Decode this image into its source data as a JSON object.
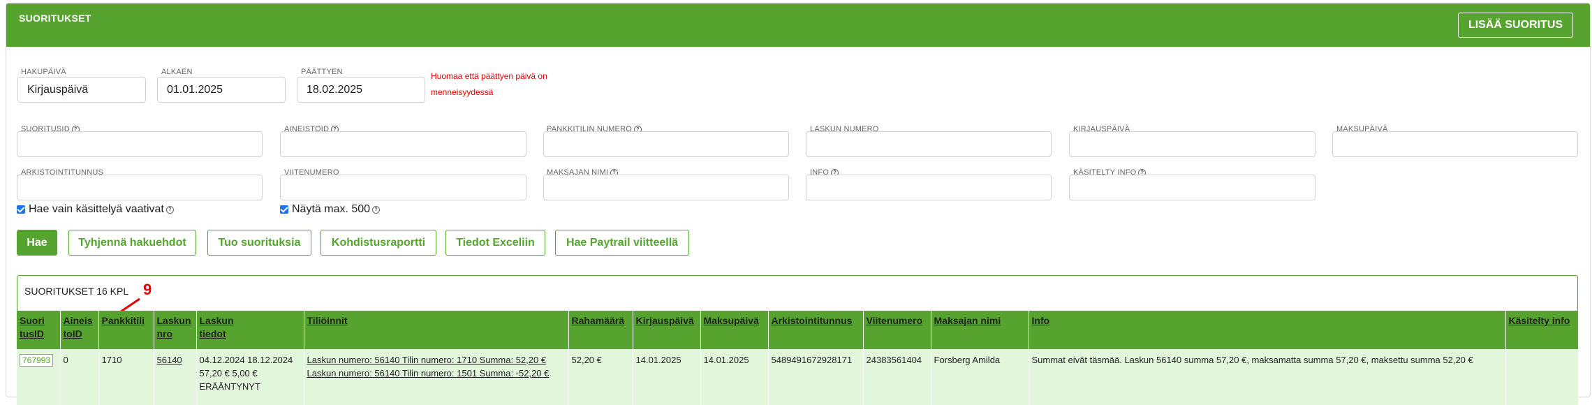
{
  "header": {
    "title": "SUORITUKSET",
    "add_button": "LISÄÄ SUORITUS"
  },
  "filters": {
    "hakupaiva": {
      "label": "HAKUPÄIVÄ",
      "value": "Kirjauspäivä"
    },
    "alkaen": {
      "label": "ALKAEN",
      "value": "01.01.2025"
    },
    "paattyen": {
      "label": "PÄÄTTYEN",
      "value": "18.02.2025"
    },
    "warning_line1": "Huomaa että päättyen päivä on",
    "warning_line2": "menneisyydessä",
    "suoritusid": {
      "label": "SUORITUSID",
      "value": ""
    },
    "aineistoid": {
      "label": "AINEISTOID",
      "value": ""
    },
    "pankkitilin_numero": {
      "label": "PANKKITILIN NUMERO",
      "value": ""
    },
    "laskun_numero": {
      "label": "LASKUN NUMERO",
      "value": ""
    },
    "kirjauspaiva": {
      "label": "KIRJAUSPÄIVÄ",
      "value": ""
    },
    "maksupaiva": {
      "label": "MAKSUPÄIVÄ",
      "value": ""
    },
    "arkistointitunnus": {
      "label": "ARKISTOINTITUNNUS",
      "value": ""
    },
    "viitenumero": {
      "label": "VIITENUMERO",
      "value": ""
    },
    "maksajan_nimi": {
      "label": "MAKSAJAN NIMI",
      "value": ""
    },
    "info": {
      "label": "INFO",
      "value": ""
    },
    "kasitelty_info": {
      "label": "KÄSITELTY INFO",
      "value": ""
    },
    "chk_kasittelya": {
      "label": "Hae vain käsittelyä vaativat",
      "checked": true
    },
    "chk_max500": {
      "label": "Näytä max. 500",
      "checked": true
    }
  },
  "actions": {
    "hae": "Hae",
    "tyhjenna": "Tyhjennä hakuehdot",
    "tuo": "Tuo suorituksia",
    "kohdistus": "Kohdistusraportti",
    "excel": "Tiedot Exceliin",
    "paytrail": "Hae Paytrail viitteellä"
  },
  "results": {
    "title": "SUORITUKSET 16 KPL",
    "annotation": "9",
    "columns": {
      "suoritusid_1": "Suori",
      "suoritusid_2": "tusID",
      "aineistoid_1": "Aineis",
      "aineistoid_2": "toID",
      "pankkitili": "Pankkitili",
      "laskunnro_1": "Laskun",
      "laskunnro_2": "nro",
      "laskuntiedot_1": "Laskun",
      "laskuntiedot_2": "tiedot",
      "tiliointi": "Tiliöinnit",
      "rahamaara": "Rahamäärä",
      "kirjauspaiva": "Kirjauspäivä",
      "maksupaiva": "Maksupäivä",
      "arkistointitunnus": "Arkistointitunnus",
      "viitenumero": "Viitenumero",
      "maksajan_nimi": "Maksajan nimi",
      "info": "Info",
      "kasitelty_info": "Käsitelty info"
    },
    "row": {
      "suoritusid": "767993",
      "aineistoid": "0",
      "pankkitili": "1710",
      "laskunnro": "56140",
      "laskuntiedot_1": "04.12.2024 18.12.2024",
      "laskuntiedot_2": "57,20 € 5,00 €",
      "laskuntiedot_3": "ERÄÄNTYNYT",
      "tiliointi_1": "Laskun numero: 56140 Tilin numero: 1710 Summa: 52,20 €",
      "tiliointi_2": "Laskun numero: 56140 Tilin numero: 1501 Summa: -52,20 €",
      "rahamaara": "52,20 €",
      "kirjauspaiva": "14.01.2025",
      "maksupaiva": "14.01.2025",
      "arkistointitunnus": "5489491672928171",
      "viitenumero": "24383561404",
      "maksajan_nimi": "Forsberg Amilda",
      "info": "Summat eivät täsmää. Laskun 56140 summa 57,20 €, maksamatta summa 57,20 €, maksettu summa 52,20 €",
      "kasitelty_info": ""
    }
  },
  "colors": {
    "primary": "#56a42f",
    "row_bg": "#e2f6dc",
    "warning": "#e60000"
  }
}
